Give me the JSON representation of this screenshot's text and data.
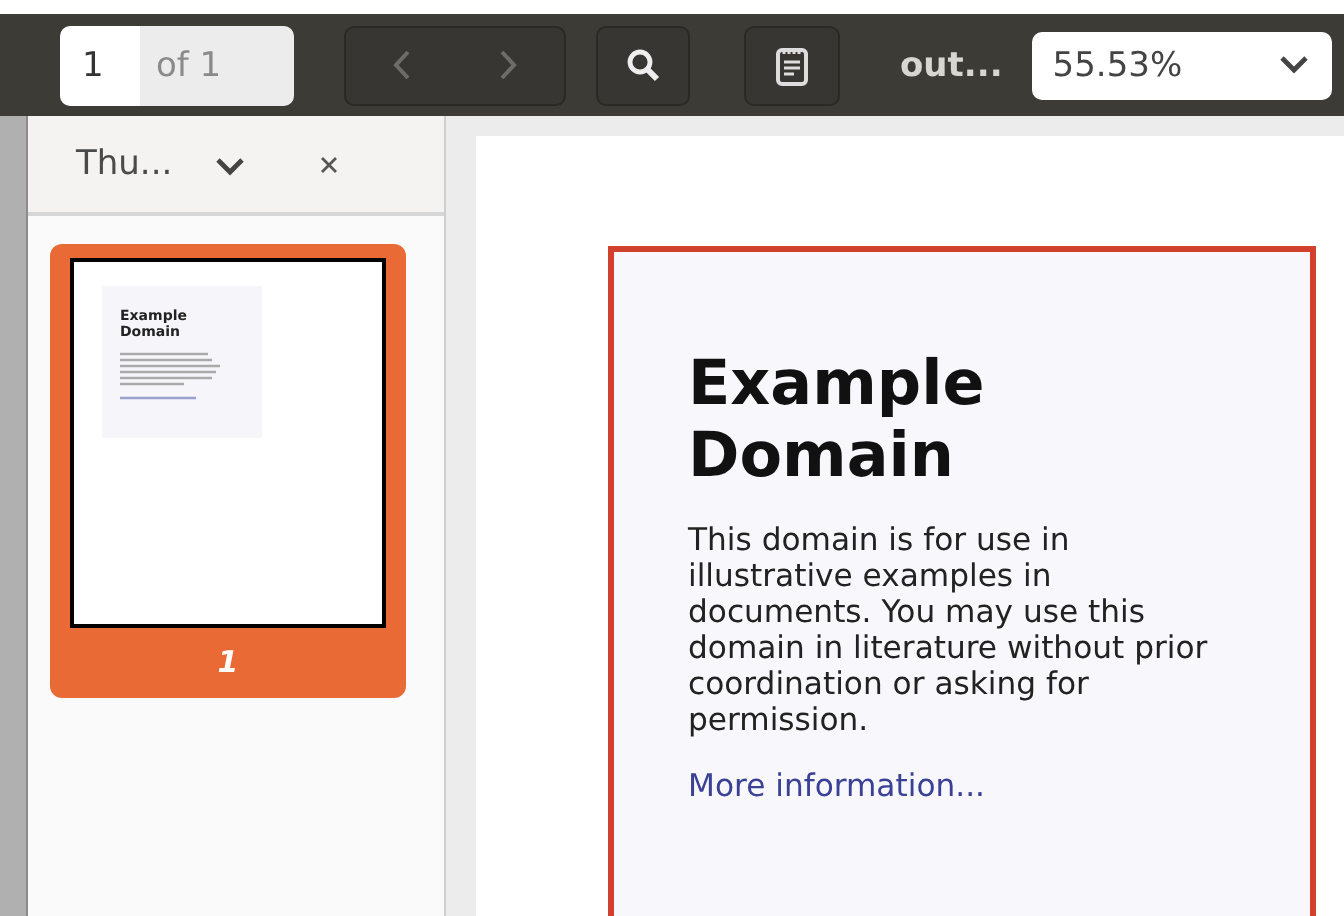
{
  "toolbar": {
    "page_number": "1",
    "page_count": "of 1",
    "title": "out...",
    "zoom": "55.53%"
  },
  "sidebar": {
    "title": "Thu...",
    "thumbnails": [
      {
        "label": "1",
        "heading": "Example Domain",
        "selected": true
      }
    ]
  },
  "document": {
    "heading": "Example Domain",
    "paragraph": "This domain is for use in illustrative examples in documents. You may use this domain in literature without prior coordination or asking for permission.",
    "link": "More information..."
  }
}
